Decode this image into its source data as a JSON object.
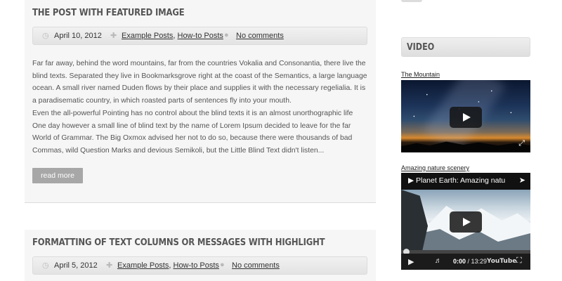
{
  "posts": [
    {
      "title": "THE POST WITH FEATURED IMAGE",
      "date": "April 10, 2012",
      "categories": [
        "Example Posts",
        "How-to Posts"
      ],
      "comments": "No comments",
      "paragraphs": [
        "Far far away, behind the word mountains, far from the countries Vokalia and Consonantia, there live the blind texts. Separated they live in Bookmarksgrove right at the coast of the Semantics, a large language ocean. A small river named Duden flows by their place and supplies it with the necessary regelialia. It is a paradisematic country, in which roasted parts of sentences fly into your mouth.",
        "Even the all-powerful Pointing has no control about the blind texts it is an almost unorthographic life One day however a small line of blind text by the name of Lorem Ipsum decided to leave for the far World of Grammar. The Big Oxmox advised her not to do so, because there were thousands of bad Commas, wild Question Marks and devious Semikoli, but the Little Blind Text didn't listen..."
      ],
      "read_more": "read more"
    },
    {
      "title": "FORMATTING OF TEXT COLUMNS OR MESSAGES WITH HIGHLIGHT",
      "date": "April 5, 2012",
      "categories": [
        "Example Posts",
        "How-to Posts"
      ],
      "comments": "No comments"
    }
  ],
  "sidebar": {
    "widget_title": "VIDEO",
    "videos": [
      {
        "label": "The Mountain"
      },
      {
        "label": "Amazing nature scenery",
        "player_title": "Planet Earth: Amazing natu",
        "time_current": "0:00",
        "time_total": "13:29",
        "progress": 0.0,
        "brand": "YouTube"
      }
    ]
  },
  "icons": {
    "date": "clock-icon",
    "category": "pin-icon",
    "comments": "comment-bubble-icon",
    "play": "play-icon",
    "fullscreen": "fullscreen-icon",
    "share": "share-icon",
    "volume": "volume-icon"
  },
  "colors": {
    "readmore_bg": "#a7a7a7",
    "post_bg": "#f6f6f6",
    "meta_bar": "#e8e8e8"
  }
}
